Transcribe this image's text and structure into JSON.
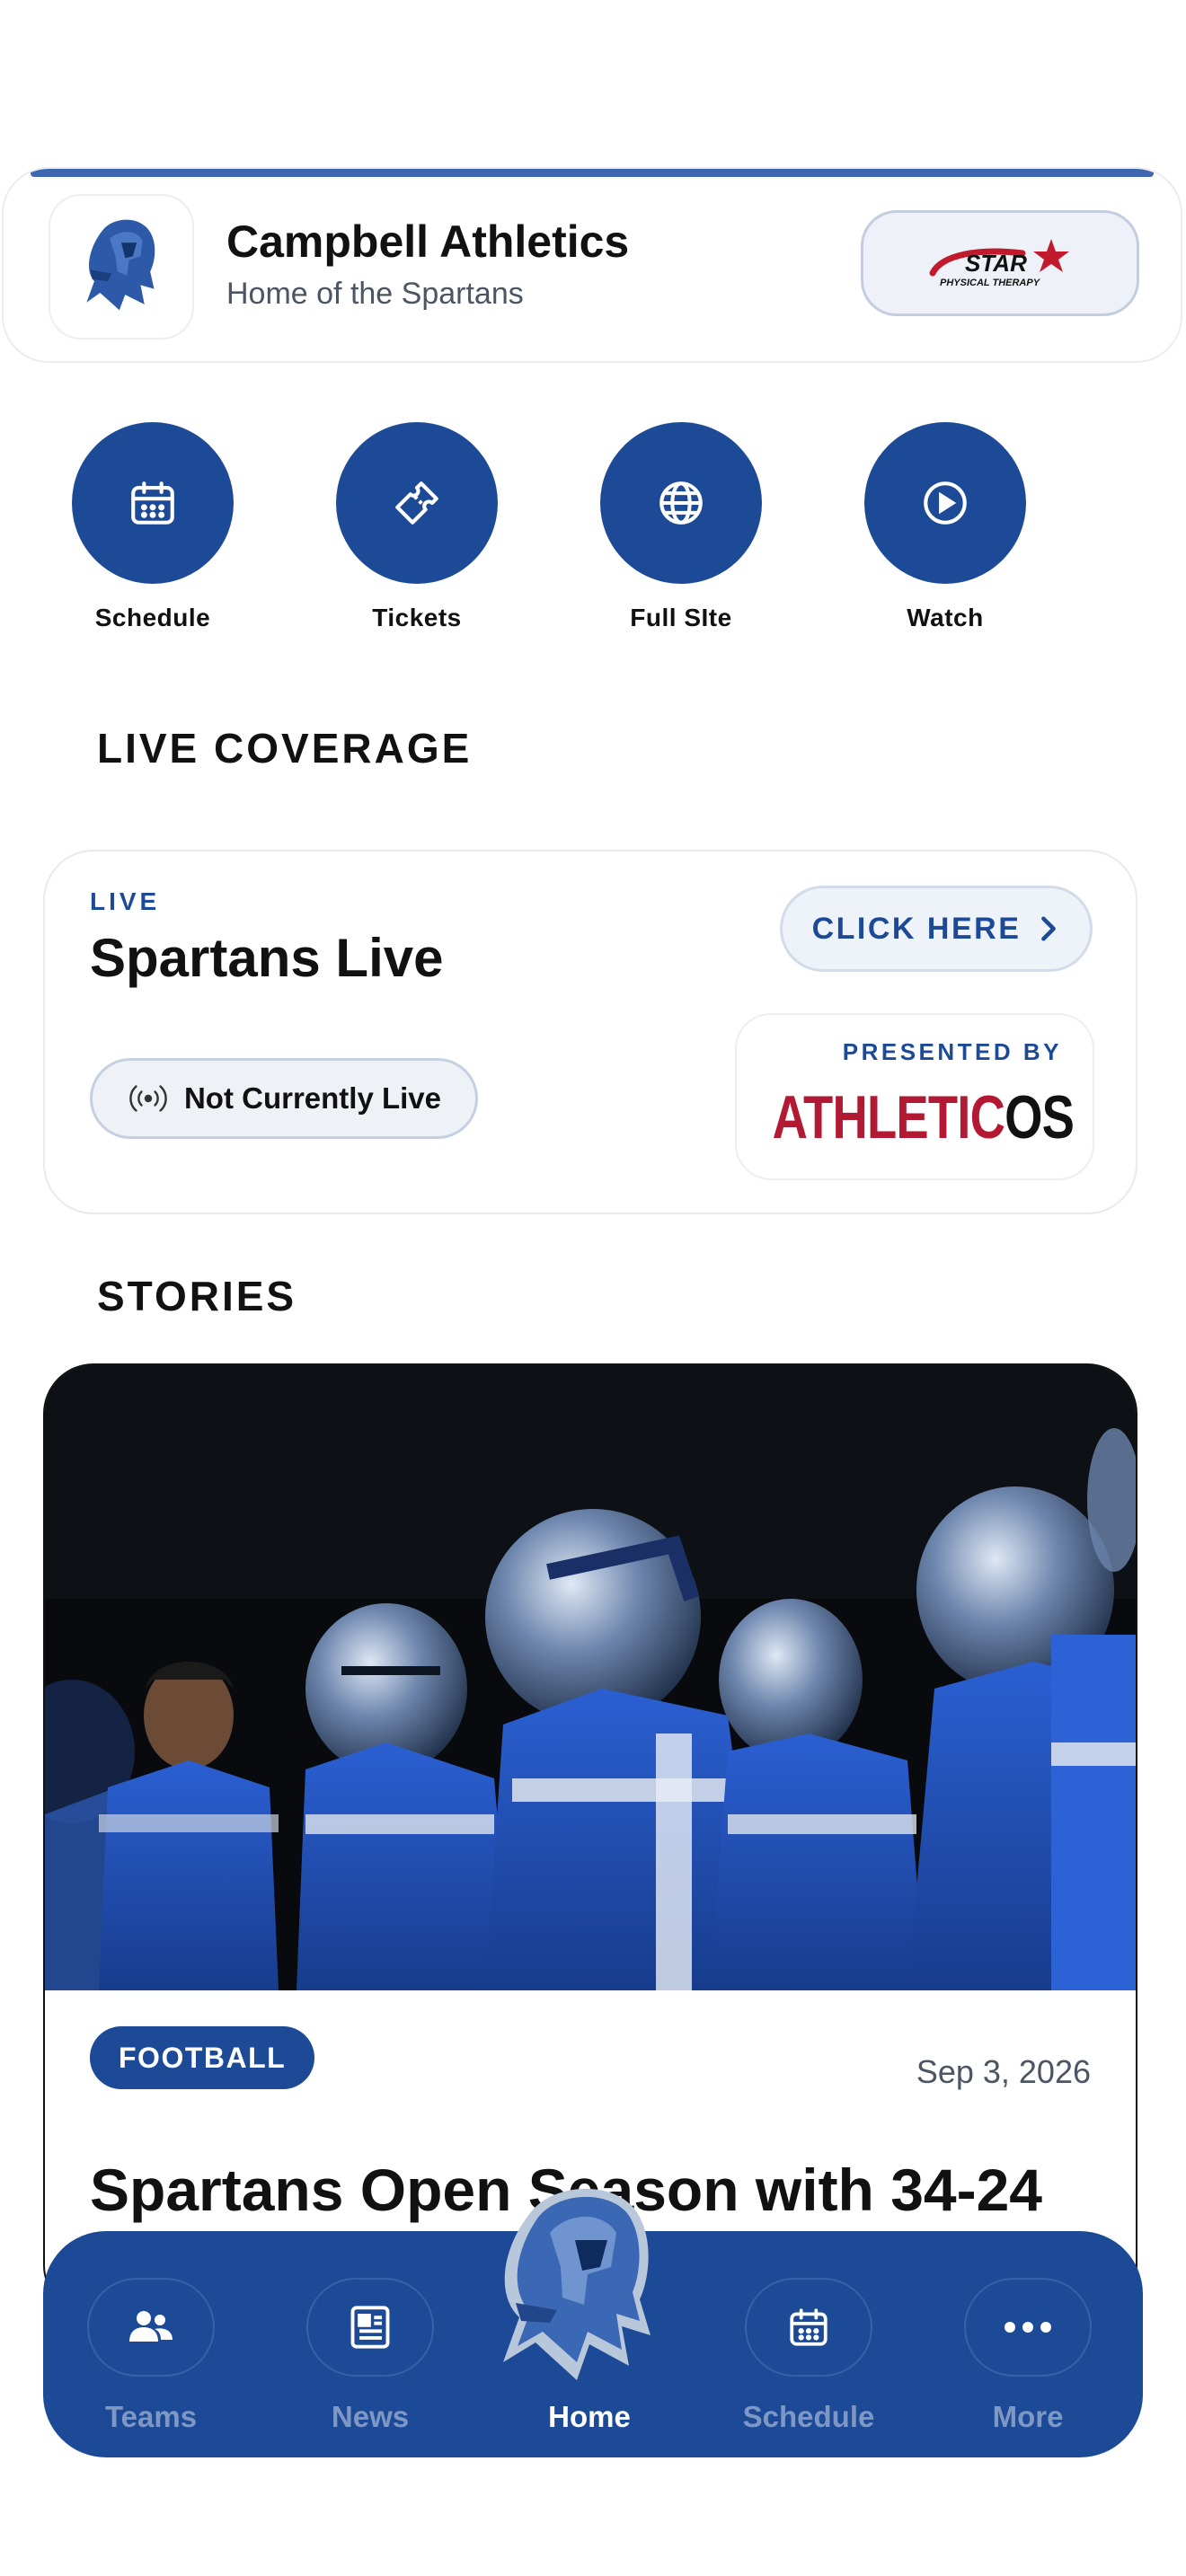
{
  "header": {
    "title": "Campbell Athletics",
    "subtitle": "Home of the Spartans",
    "sponsor": {
      "name": "STAR",
      "tagline": "PHYSICAL THERAPY"
    }
  },
  "quick_actions": [
    {
      "label": "Schedule",
      "icon": "calendar-icon"
    },
    {
      "label": "Tickets",
      "icon": "ticket-icon"
    },
    {
      "label": "Full SIte",
      "icon": "globe-icon"
    },
    {
      "label": "Watch",
      "icon": "play-icon"
    }
  ],
  "live_coverage": {
    "heading": "LIVE COVERAGE",
    "tag": "LIVE",
    "title": "Spartans Live",
    "cta": "CLICK HERE",
    "status": "Not Currently Live",
    "presented_by": "PRESENTED BY",
    "presenter_logo": {
      "part1": "ATHLETIC",
      "part2": "OS"
    }
  },
  "stories": {
    "heading": "STORIES",
    "items": [
      {
        "tag": "FOOTBALL",
        "date": "Sep 3, 2026",
        "title": "Spartans Open Season with 34-24"
      }
    ]
  },
  "tabbar": {
    "items": [
      {
        "label": "Teams",
        "icon": "people-icon",
        "active": false
      },
      {
        "label": "News",
        "icon": "newspaper-icon",
        "active": false
      },
      {
        "label": "Home",
        "icon": "spartan-helmet-icon",
        "active": true
      },
      {
        "label": "Schedule",
        "icon": "calendar-icon",
        "active": false
      },
      {
        "label": "More",
        "icon": "more-icon",
        "active": false
      }
    ]
  },
  "colors": {
    "primary": "#1c4a96",
    "accent_line": "#3d68b0",
    "sponsor_red": "#b21a34",
    "inactive_tab": "#7f97c4"
  }
}
